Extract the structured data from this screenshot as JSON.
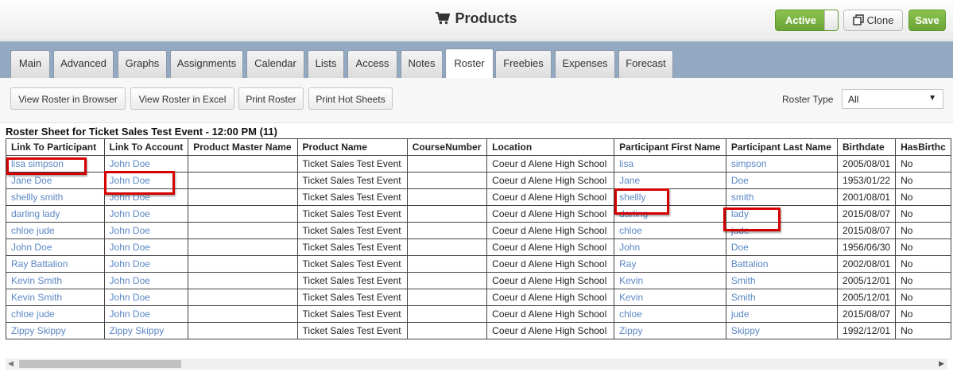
{
  "header": {
    "title": "Products",
    "title_icon": "shopping-cart-icon",
    "active_label": "Active",
    "clone_label": "Clone",
    "save_label": "Save",
    "accent_green": "#7cb342"
  },
  "tabs": [
    {
      "label": "Main"
    },
    {
      "label": "Advanced"
    },
    {
      "label": "Graphs"
    },
    {
      "label": "Assignments"
    },
    {
      "label": "Calendar"
    },
    {
      "label": "Lists"
    },
    {
      "label": "Access"
    },
    {
      "label": "Notes"
    },
    {
      "label": "Roster",
      "active": true
    },
    {
      "label": "Freebies"
    },
    {
      "label": "Expenses"
    },
    {
      "label": "Forecast"
    }
  ],
  "toolbar": {
    "view_browser": "View Roster in Browser",
    "view_excel": "View Roster in Excel",
    "print_roster": "Print Roster",
    "print_hot": "Print Hot Sheets",
    "roster_type_label": "Roster Type",
    "roster_type_value": "All"
  },
  "roster": {
    "title": "Roster Sheet for Ticket Sales Test Event - 12:00 PM (11)",
    "columns": [
      "Link To Participant",
      "Link To Account",
      "Product Master Name",
      "Product Name",
      "CourseNumber",
      "Location",
      "Participant First Name",
      "Participant Last Name",
      "Birthdate",
      "HasBirthc"
    ],
    "rows": [
      [
        "lisa simpson",
        "John Doe",
        "",
        "Ticket Sales Test Event",
        "",
        "Coeur d Alene High School",
        "lisa",
        "simpson",
        "2005/08/01",
        "No"
      ],
      [
        "Jane Doe",
        "John Doe",
        "",
        "Ticket Sales Test Event",
        "",
        "Coeur d Alene High School",
        "Jane",
        "Doe",
        "1953/01/22",
        "No"
      ],
      [
        "shellly smith",
        "John Doe",
        "",
        "Ticket Sales Test Event",
        "",
        "Coeur d Alene High School",
        "shellly",
        "smith",
        "2001/08/01",
        "No"
      ],
      [
        "darling lady",
        "John Doe",
        "",
        "Ticket Sales Test Event",
        "",
        "Coeur d Alene High School",
        "darling",
        "lady",
        "2015/08/07",
        "No"
      ],
      [
        "chloe jude",
        "John Doe",
        "",
        "Ticket Sales Test Event",
        "",
        "Coeur d Alene High School",
        "chloe",
        "jude",
        "2015/08/07",
        "No"
      ],
      [
        "John Doe",
        "John Doe",
        "",
        "Ticket Sales Test Event",
        "",
        "Coeur d Alene High School",
        "John",
        "Doe",
        "1956/06/30",
        "No"
      ],
      [
        "Ray Battalion",
        "John Doe",
        "",
        "Ticket Sales Test Event",
        "",
        "Coeur d Alene High School",
        "Ray",
        "Battalion",
        "2002/08/01",
        "No"
      ],
      [
        "Kevin Smith",
        "John Doe",
        "",
        "Ticket Sales Test Event",
        "",
        "Coeur d Alene High School",
        "Kevin",
        "Smith",
        "2005/12/01",
        "No"
      ],
      [
        "Kevin Smith",
        "John Doe",
        "",
        "Ticket Sales Test Event",
        "",
        "Coeur d Alene High School",
        "Kevin",
        "Smith",
        "2005/12/01",
        "No"
      ],
      [
        "chloe jude",
        "John Doe",
        "",
        "Ticket Sales Test Event",
        "",
        "Coeur d Alene High School",
        "chloe",
        "jude",
        "2015/08/07",
        "No"
      ],
      [
        "Zippy Skippy",
        "Zippy Skippy",
        "",
        "Ticket Sales Test Event",
        "",
        "Coeur d Alene High School",
        "Zippy",
        "Skippy",
        "1992/12/01",
        "No"
      ]
    ],
    "link_color": "#5b87c4",
    "highlight_color": "#d40000"
  }
}
